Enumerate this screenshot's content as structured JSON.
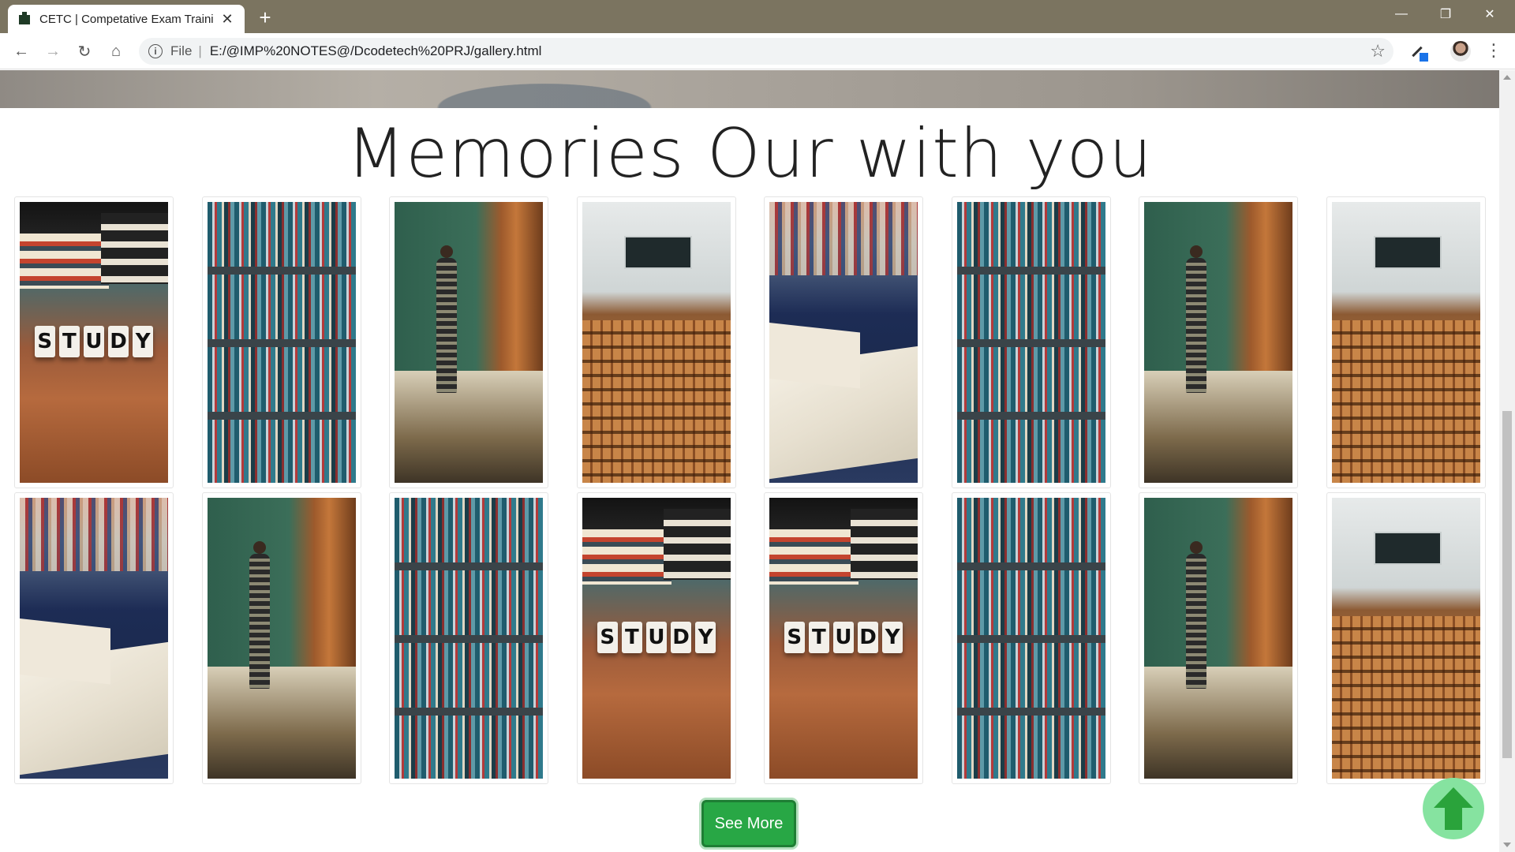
{
  "browser": {
    "tab_title": "CETC | Competative Exam Training",
    "tab_close": "✕",
    "new_tab": "+",
    "scheme_label": "File",
    "separator": "|",
    "url": "E:/@IMP%20NOTES@/Dcodetech%20PRJ/gallery.html",
    "window_controls": {
      "minimize": "—",
      "restore": "❐",
      "close": "✕"
    },
    "nav": {
      "back": "←",
      "forward": "→",
      "reload": "↻",
      "home": "⌂"
    },
    "star": "☆",
    "menu": "⋮"
  },
  "page": {
    "heading": "Memories Our with you",
    "gallery_rows": [
      [
        "study-icon-image",
        "bookshelf-image",
        "chalkboard-image",
        "lecture-hall-image",
        "open-book-image",
        "bookshelf-image",
        "chalkboard-image",
        "lecture-hall-image"
      ],
      [
        "open-book-image",
        "chalkboard-image",
        "bookshelf-image",
        "study-icon-image",
        "study-icon-image",
        "bookshelf-image",
        "chalkboard-image",
        "lecture-hall-image"
      ]
    ],
    "study_word": [
      "S",
      "T",
      "U",
      "D",
      "Y"
    ],
    "see_more_label": "See More",
    "colors": {
      "button": "#28a745",
      "to_top": "#86e3a0",
      "arrow": "#2aa33b"
    }
  }
}
